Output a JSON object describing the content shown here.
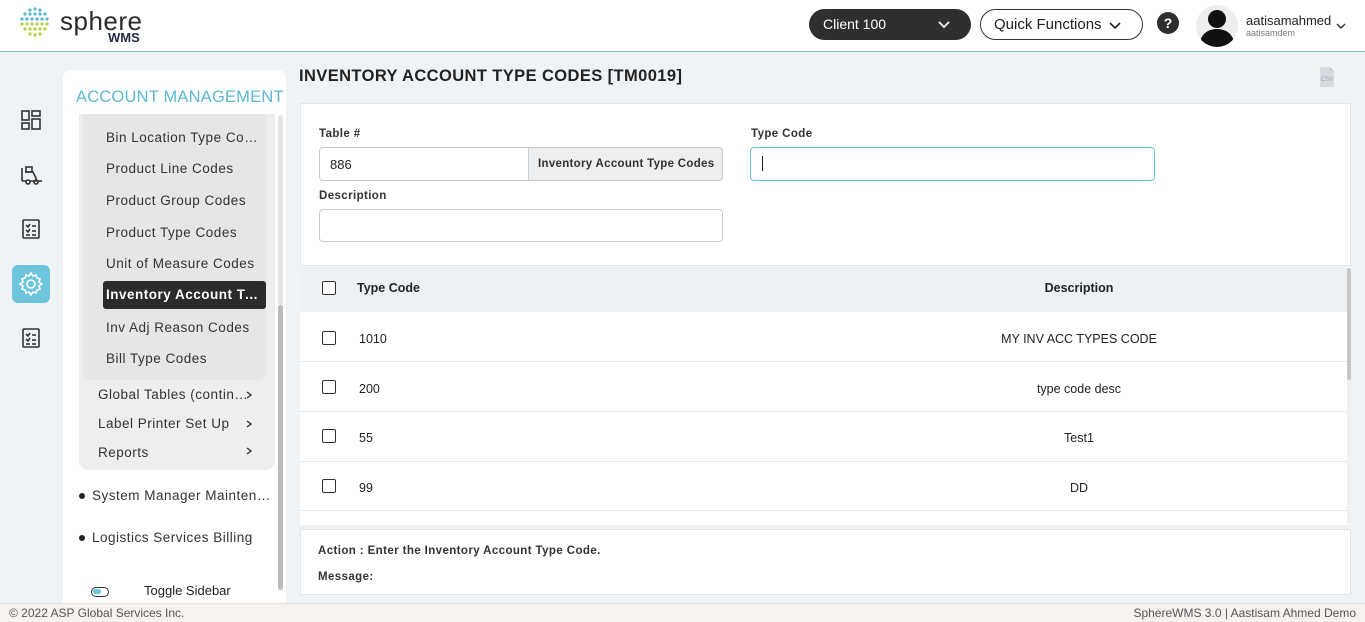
{
  "header": {
    "logo_text": "sphere",
    "logo_sub": "WMS",
    "client_label": "Client 100",
    "quick_functions_label": "Quick Functions",
    "help_label": "?",
    "user_name": "aatisamahmed",
    "user_sub": "aatisamdem"
  },
  "rail": {
    "items": [
      "dashboard-icon",
      "forklift-icon",
      "checklist-icon",
      "settings-icon",
      "report-icon"
    ],
    "active_index": 3
  },
  "sidebar": {
    "title": "ACCOUNT MANAGEMENT",
    "sub_items": [
      "Bin Location Type Codes",
      "Product Line Codes",
      "Product Group Codes",
      "Product Type Codes",
      "Unit of Measure Codes",
      "Inventory Account Type Codes",
      "Inv Adj Reason Codes",
      "Bill Type Codes"
    ],
    "active_sub_index": 5,
    "group_items": [
      "Global Tables (continued)",
      "Label Printer Set Up",
      "Reports"
    ],
    "bullet_items": [
      "System Manager Maintenance",
      "Logistics Services Billing"
    ],
    "toggle_label": "Toggle Sidebar"
  },
  "main": {
    "page_title": "INVENTORY ACCOUNT TYPE CODES [TM0019]",
    "csv_label": "CSV",
    "form": {
      "table_label": "Table #",
      "table_value": "886",
      "table_addon": "Inventory Account Type Codes",
      "type_code_label": "Type Code",
      "type_code_value": "",
      "description_label": "Description",
      "description_value": ""
    },
    "table": {
      "columns": [
        "Type Code",
        "Description"
      ],
      "rows": [
        {
          "code": "1010",
          "description": "MY INV ACC TYPES CODE"
        },
        {
          "code": "200",
          "description": "type code desc"
        },
        {
          "code": "55",
          "description": "Test1"
        },
        {
          "code": "99",
          "description": "DD"
        }
      ]
    },
    "action_text": "Action :  Enter the Inventory Account Type Code.",
    "message_text": "Message:"
  },
  "footer": {
    "left": "© 2022 ASP Global Services Inc.",
    "right": "SphereWMS 3.0 | Aastisam Ahmed Demo"
  },
  "colors": {
    "accent": "#6ec5de",
    "dark": "#2b2b2b",
    "title_blue": "#5bb8d4"
  }
}
